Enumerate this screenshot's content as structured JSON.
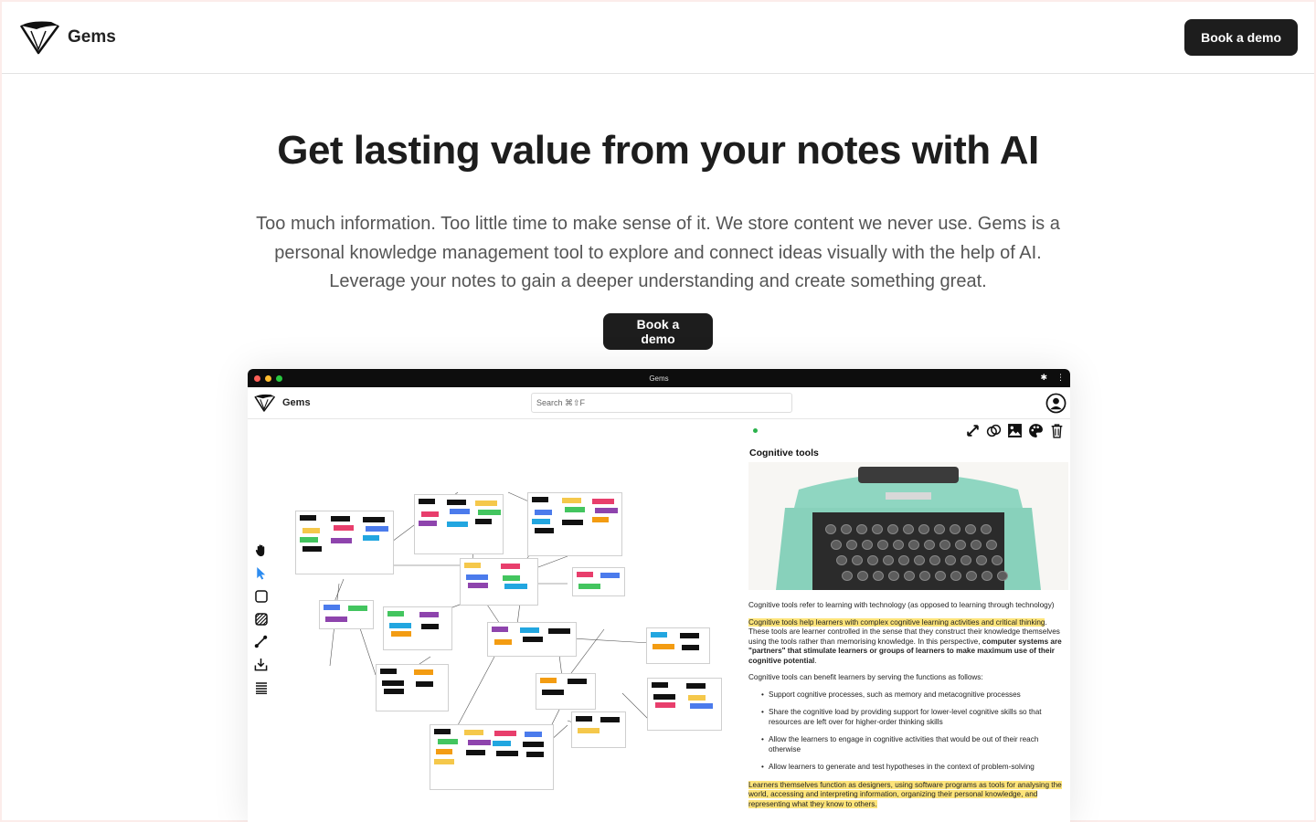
{
  "nav": {
    "brand": "Gems",
    "cta": "Book a demo"
  },
  "hero": {
    "title": "Get lasting value from your notes with AI",
    "subtitle": "Too much information. Too little time to make sense of it. We store content we never use. Gems is a personal knowledge management tool to explore and connect ideas visually with the help of AI. Leverage your notes to gain a deeper understanding and create something great.",
    "cta": "Book a demo"
  },
  "app": {
    "window_title": "Gems",
    "brand": "Gems",
    "search_placeholder": "Search  ⌘⇧F",
    "tools": [
      "hand-icon",
      "pointer-icon",
      "square-icon",
      "hatch-icon",
      "connector-icon",
      "import-icon",
      "list-icon"
    ],
    "panel": {
      "title": "Cognitive tools",
      "icons": [
        "expand-icon",
        "link-circles-icon",
        "image-icon",
        "palette-icon",
        "trash-icon"
      ],
      "paragraph_1": "Cognitive tools refer to learning with technology (as opposed to learning through technology)",
      "paragraph_2_highlight": "Cognitive tools help learners with complex cognitive learning activities and critical thinking",
      "paragraph_2_rest": ". These tools are learner controlled in the sense that they construct their knowledge themselves using the tools rather than memorising knowledge. In this perspective, ",
      "paragraph_2_bold": "computer systems are \"partners\" that stimulate learners or groups of learners to make maximum use of their cognitive potential",
      "paragraph_2_end": ".",
      "paragraph_3": "Cognitive tools can benefit learners by serving the functions as follows:",
      "bullets": [
        "Support cognitive processes, such as memory and metacognitive processes",
        "Share the cognitive load by providing support for lower-level cognitive skills so that resources are left over for higher-order thinking skills",
        "Allow the learners to engage in cognitive activities that would be out of their reach otherwise",
        "Allow learners to generate and test hypotheses in the context of problem-solving"
      ],
      "paragraph_4_highlight": "Learners themselves function as designers, using software programs as tools for analysing the world, accessing and interpreting information, organizing their personal knowledge, and representing what they know to others."
    }
  },
  "colors": {
    "dark": "#1d1d1d",
    "highlight": "#fde47a",
    "traffic_red": "#ff5f57",
    "traffic_yellow": "#febc2e",
    "traffic_green": "#28c840",
    "status_green": "#2bb24c"
  }
}
